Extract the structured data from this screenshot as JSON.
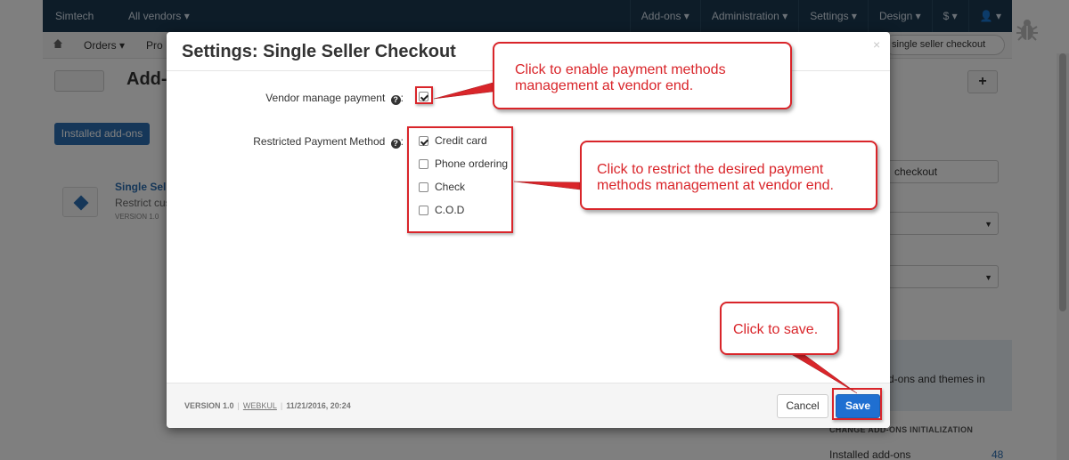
{
  "background": {
    "topbar": {
      "brand": "Simtech",
      "vendors": "All vendors ▾",
      "nav": [
        "Add-ons ▾",
        "Administration ▾",
        "Settings ▾",
        "Design ▾",
        "$ ▾",
        "👤 ▾"
      ]
    },
    "breadcrumb": {
      "orders": "Orders ▾",
      "products": "Pro"
    },
    "search_value": "single seller checkout",
    "page_title": "Add-",
    "installed_button": "Installed add-ons",
    "addon": {
      "name": "Single Selle",
      "description": "Restrict cus",
      "version": "VERSION 1.0"
    },
    "sidepanel": {
      "filter_value": "checkout",
      "info_text": "d-ons and themes in",
      "changes_caption": "CHANGE ADD-ONS INITIALIZATION",
      "installed_label": "Installed add-ons",
      "installed_count": "48"
    }
  },
  "modal": {
    "title": "Settings: Single Seller Checkout",
    "close": "×",
    "vendor_manage_label": "Vendor manage payment",
    "vendor_manage_checked": true,
    "restricted_label": "Restricted Payment Method",
    "help_icon": "?",
    "colon": ":",
    "payment_methods": [
      {
        "label": "Credit card",
        "checked": true
      },
      {
        "label": "Phone ordering",
        "checked": false
      },
      {
        "label": "Check",
        "checked": false
      },
      {
        "label": "C.O.D",
        "checked": false
      }
    ],
    "footer": {
      "version": "VERSION 1.0",
      "vendor": "WEBKUL",
      "date": "11/21/2016, 20:24",
      "separator": "|"
    },
    "cancel_label": "Cancel",
    "save_label": "Save"
  },
  "annotations": {
    "callout1": "Click to enable payment methods management at vendor end.",
    "callout2": "Click to restrict the desired payment methods management at vendor end.",
    "callout3": "Click to save."
  },
  "colors": {
    "topbar": "#1b3850",
    "primary": "#1f6fd1",
    "annotation": "#d9252a"
  }
}
